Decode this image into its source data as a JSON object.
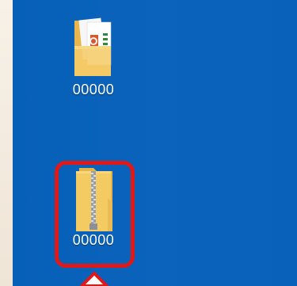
{
  "desktop": {
    "background_color": "#0a61b9",
    "icons": [
      {
        "label": "00000",
        "type": "folder-with-documents",
        "icon_name": "folder-documents-icon",
        "selected": false
      },
      {
        "label": "00000",
        "type": "zip-folder",
        "icon_name": "zipped-folder-icon",
        "selected": true
      }
    ]
  },
  "annotation": {
    "highlight_color": "#e01818",
    "pointer": "arrow-up-icon"
  }
}
